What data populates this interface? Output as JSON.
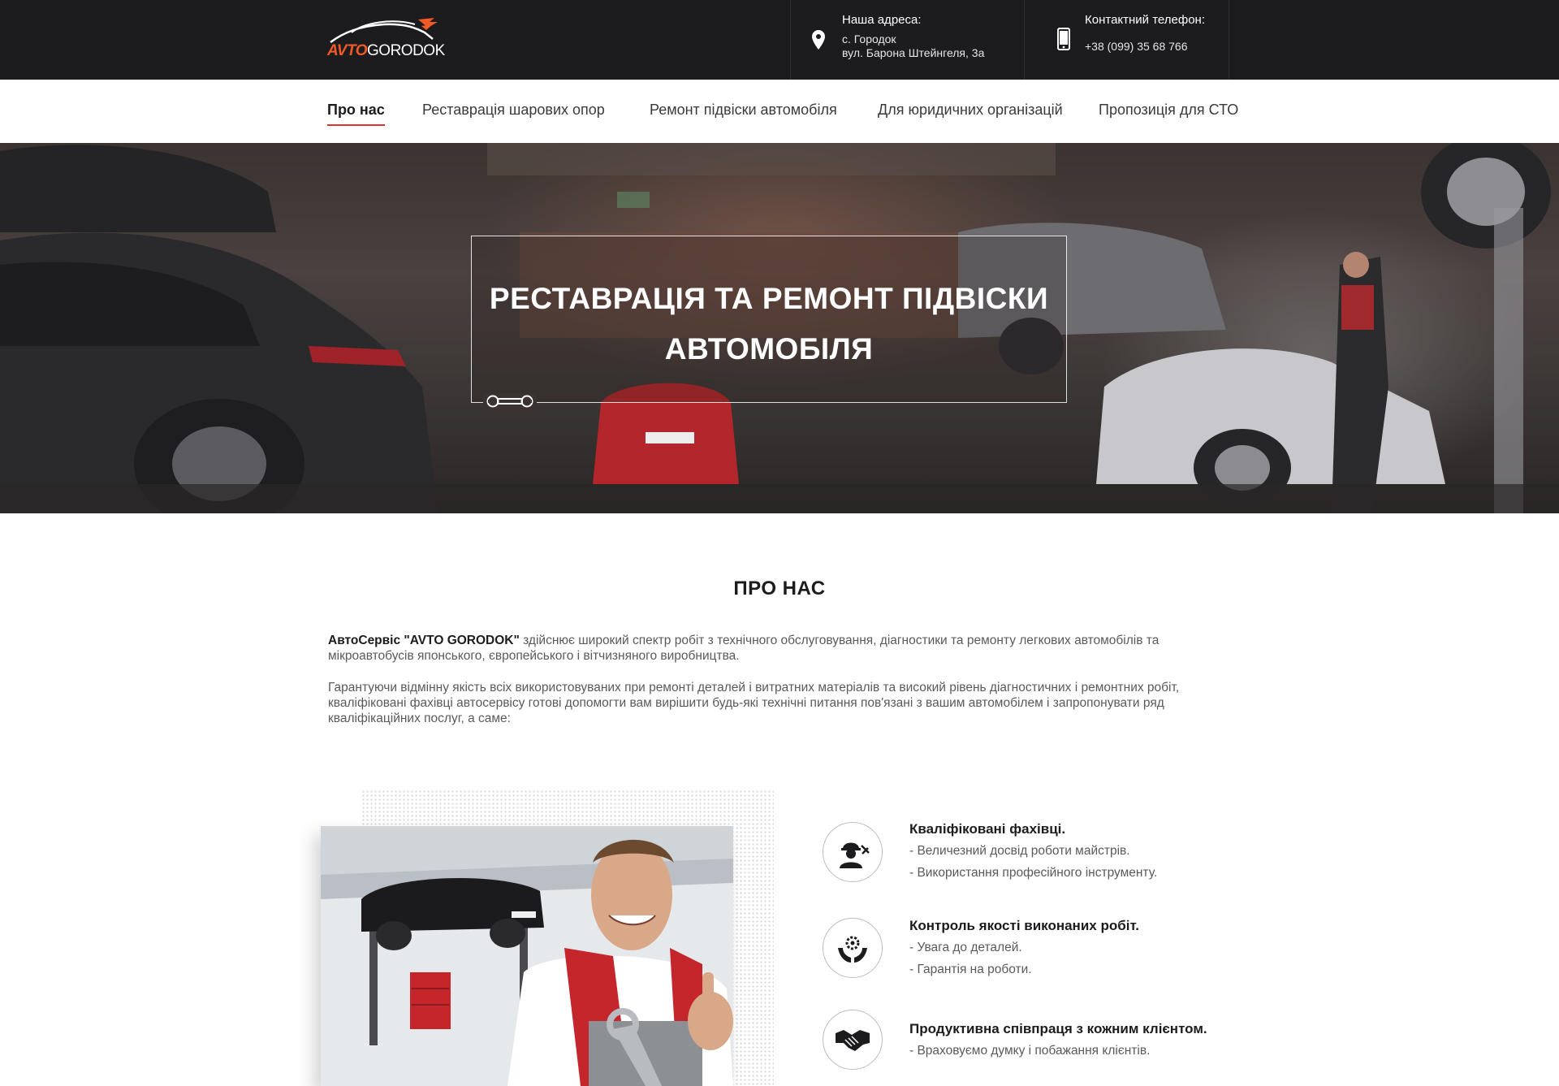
{
  "header": {
    "logo": {
      "part1": "AVTO",
      "part2": "GORODOK"
    },
    "address": {
      "title": "Наша адреса:",
      "line1": "с. Городок",
      "line2": "вул. Барона Штейнгеля, 3а"
    },
    "phone": {
      "title": "Контактний телефон:",
      "number": "+38 (099) 35 68 766"
    }
  },
  "nav": {
    "items": [
      {
        "label": "Про нас"
      },
      {
        "label": "Реставрація шарових опор"
      },
      {
        "label": "Ремонт підвіски автомобіля"
      },
      {
        "label": "Для юридичних організацій"
      },
      {
        "label": "Пропозиція для СТО"
      }
    ]
  },
  "hero": {
    "line1": "РЕСТАВРАЦІЯ ТА РЕМОНТ ПІДВІСКИ",
    "line2": "АВТОМОБІЛЯ"
  },
  "about": {
    "title": "ПРО НАС",
    "p1_bold": "АвтоСервіс \"AVTO GORODOK\"",
    "p1_rest": " здійснює широкий спектр робіт з технічного обслуговування, діагностики та ремонту легкових автомобілів та мікроавтобусів японського, європейського і вітчизняного виробництва.",
    "p2": "Гарантуючи відмінну якість всіх використовуваних при ремонті деталей і витратних матеріалів та високий рівень діагностичних і ремонтних робіт, кваліфіковані фахівці автосервісу готові допомогти вам вирішити будь-які технічні питання пов'язані з вашим автомобілем і запропонувати ряд кваліфікаційних послуг, а саме:"
  },
  "features": [
    {
      "icon": "mechanic-icon",
      "title": "Кваліфіковані фахівці.",
      "lines": [
        "- Величезний досвід роботи майстрів.",
        "- Використання професійного інструменту."
      ]
    },
    {
      "icon": "quality-gear-hands-icon",
      "title": "Контроль якості виконаних робіт.",
      "lines": [
        "- Увага до деталей.",
        "- Гарантія на роботи."
      ]
    },
    {
      "icon": "handshake-icon",
      "title": "Продуктивна співпраця з кожним клієнтом.",
      "lines": [
        "- Враховуємо думку і побажання клієнтів."
      ]
    }
  ],
  "colors": {
    "dark": "#1c1c1f",
    "accent": "#e0322b",
    "logo_orange": "#f15a24"
  }
}
